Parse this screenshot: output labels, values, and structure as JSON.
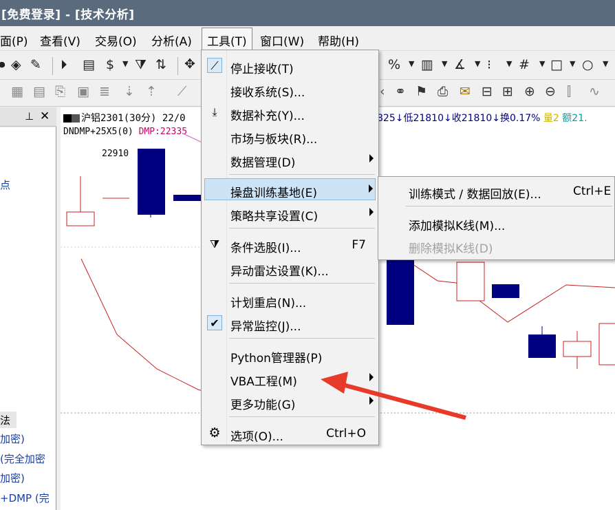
{
  "window": {
    "title": "[免费登录] - [技术分析]"
  },
  "menubar": {
    "items": [
      {
        "label": "面(P)"
      },
      {
        "label": "查看(V)"
      },
      {
        "label": "交易(O)"
      },
      {
        "label": "分析(A)"
      },
      {
        "label": "工具(T)"
      },
      {
        "label": "窗口(W)"
      },
      {
        "label": "帮助(H)"
      }
    ]
  },
  "toolbar": {
    "percent": "%",
    "dollar": "$"
  },
  "left_panel": {
    "pin": "ᵖ",
    "close": "✕",
    "items": [
      {
        "label": "点"
      },
      {
        "label": "法"
      },
      {
        "label": "加密)"
      },
      {
        "label": "(完全加密"
      },
      {
        "label": "加密)"
      },
      {
        "label": "+DMP (完"
      }
    ]
  },
  "chart": {
    "header_left": "沪铝2301(30分) 22/0",
    "header_right_items": [
      {
        "text": "825↓低21810↓收21810↓换0.17%",
        "color": "#000080"
      },
      {
        "text": "量2",
        "color": "#c8b400"
      },
      {
        "text": "额21.",
        "color": "#00a0a0"
      }
    ],
    "indicator_label": "DNDMP+25X5(0)",
    "dmp_label": "DMP:22335",
    "price_label": "22910"
  },
  "tools_menu": {
    "items": [
      {
        "label": "停止接收(T)",
        "icon": "link-icon",
        "iconbox": true
      },
      {
        "label": "接收系统(S)..."
      },
      {
        "label": "数据补充(Y)...",
        "icon": "download-icon"
      },
      {
        "label": "市场与板块(R)..."
      },
      {
        "label": "数据管理(D)",
        "submenu": true
      },
      {
        "label": "操盘训练基地(E)",
        "submenu": true,
        "highlighted": true
      },
      {
        "label": "策略共享设置(C)",
        "submenu": true
      },
      {
        "label": "条件选股(I)...",
        "shortcut": "F7",
        "icon": "filter-icon"
      },
      {
        "label": "异动雷达设置(K)..."
      },
      {
        "label": "计划重启(N)..."
      },
      {
        "label": "异常监控(J)...",
        "icon": "check-icon",
        "iconbox": true
      },
      {
        "label": "Python管理器(P)"
      },
      {
        "label": "VBA工程(M)",
        "submenu": true
      },
      {
        "label": "更多功能(G)",
        "submenu": true
      },
      {
        "label": "选项(O)...",
        "shortcut": "Ctrl+O",
        "icon": "gear-icon"
      }
    ]
  },
  "training_submenu": {
    "items": [
      {
        "label": "训练模式 / 数据回放(E)...",
        "shortcut": "Ctrl+E"
      },
      {
        "label": "添加模拟K线(M)..."
      },
      {
        "label": "删除模拟K线(D)",
        "disabled": true
      }
    ]
  },
  "colors": {
    "titlebar": "#5b6b7e",
    "candle_down": "#000080",
    "candle_up": "#c82020",
    "dmp": "#cc0066",
    "annotation_arrow": "#e83a2a"
  }
}
